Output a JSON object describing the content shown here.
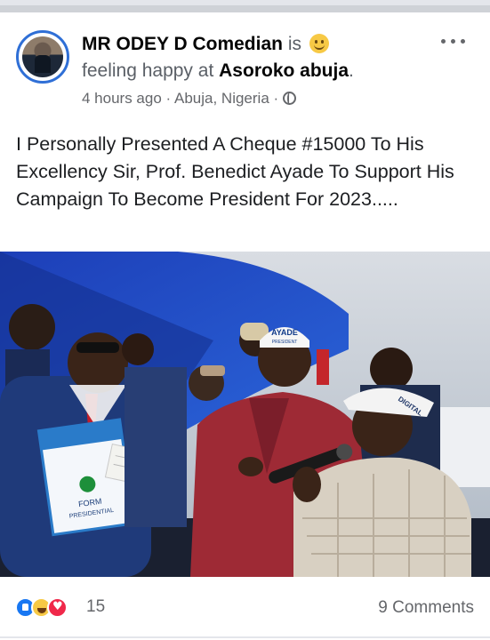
{
  "post": {
    "author": "MR ODEY  D Comedian",
    "is_word": "is",
    "feeling": "feeling happy at",
    "location_tag": "Asoroko abuja",
    "location_suffix": ".",
    "time": "4 hours ago",
    "separator": "·",
    "place": "Abuja, Nigeria",
    "privacy_icon": "globe-icon",
    "feeling_icon": "smiley-icon",
    "text": "I Personally Presented A Cheque #15000 To His Excellency Sir, Prof. Benedict Ayade To Support His Campaign To Become President For 2023.....",
    "photo_text": {
      "cap1": "AYADE",
      "cap1b": "PRESIDENT",
      "cap2": "DIGITAL",
      "form": "FORM",
      "form2": "PRESIDENTIAL"
    }
  },
  "footer": {
    "reaction_icons": [
      "like-icon",
      "haha-icon",
      "love-icon"
    ],
    "reaction_count": "15",
    "comments": "9 Comments"
  },
  "colors": {
    "accent": "#1877f2",
    "avatar_ring": "#2f6fd6",
    "secondary_text": "#65676b"
  }
}
